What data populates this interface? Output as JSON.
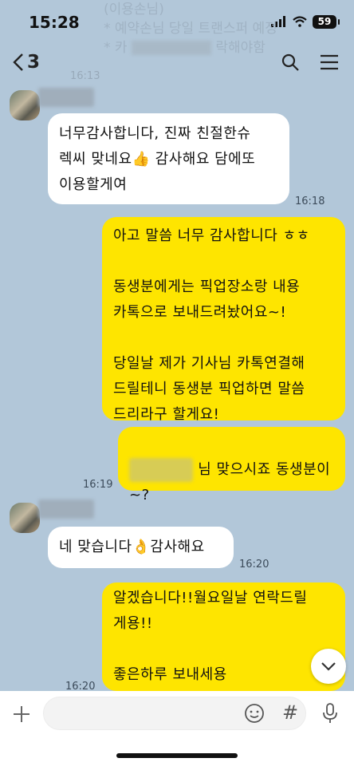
{
  "status_bar": {
    "time": "15:28",
    "battery": "59"
  },
  "header": {
    "back_count": "3"
  },
  "notice": {
    "line1": "(이용손님)",
    "line2": "* 예약손님 당일 트랜스퍼 예정",
    "line3": "* 카",
    "line3_tail": "락해야함"
  },
  "messages": [
    {
      "side": "in",
      "text": "너무감사합니다, 진짜 친절한슈\n렉씨 맞네요👍 감사해요 담에또\n이용할게여",
      "time": "16:18"
    },
    {
      "side": "out",
      "text": "아고 말씀 너무 감사합니다 ㅎㅎ\n\n동생분에게는 픽업장소랑 내용\n카톡으로 보내드려놨어요~!\n\n당일날 제가 기사님 카톡연결해\n드릴테니 동생분 픽업하면 말씀\n드리라구 할게요!"
    },
    {
      "side": "out",
      "text_tail": " 님 맞으시죠 동생분이\n~?",
      "time": "16:19"
    },
    {
      "side": "in",
      "text": "네 맞습니다👌감사해요",
      "time": "16:20"
    },
    {
      "side": "out",
      "text": "알겠습니다!!월요일날 연락드릴\n게용!!\n\n좋은하루 보내세용",
      "time": "16:20"
    }
  ],
  "faded_time": "16:13"
}
